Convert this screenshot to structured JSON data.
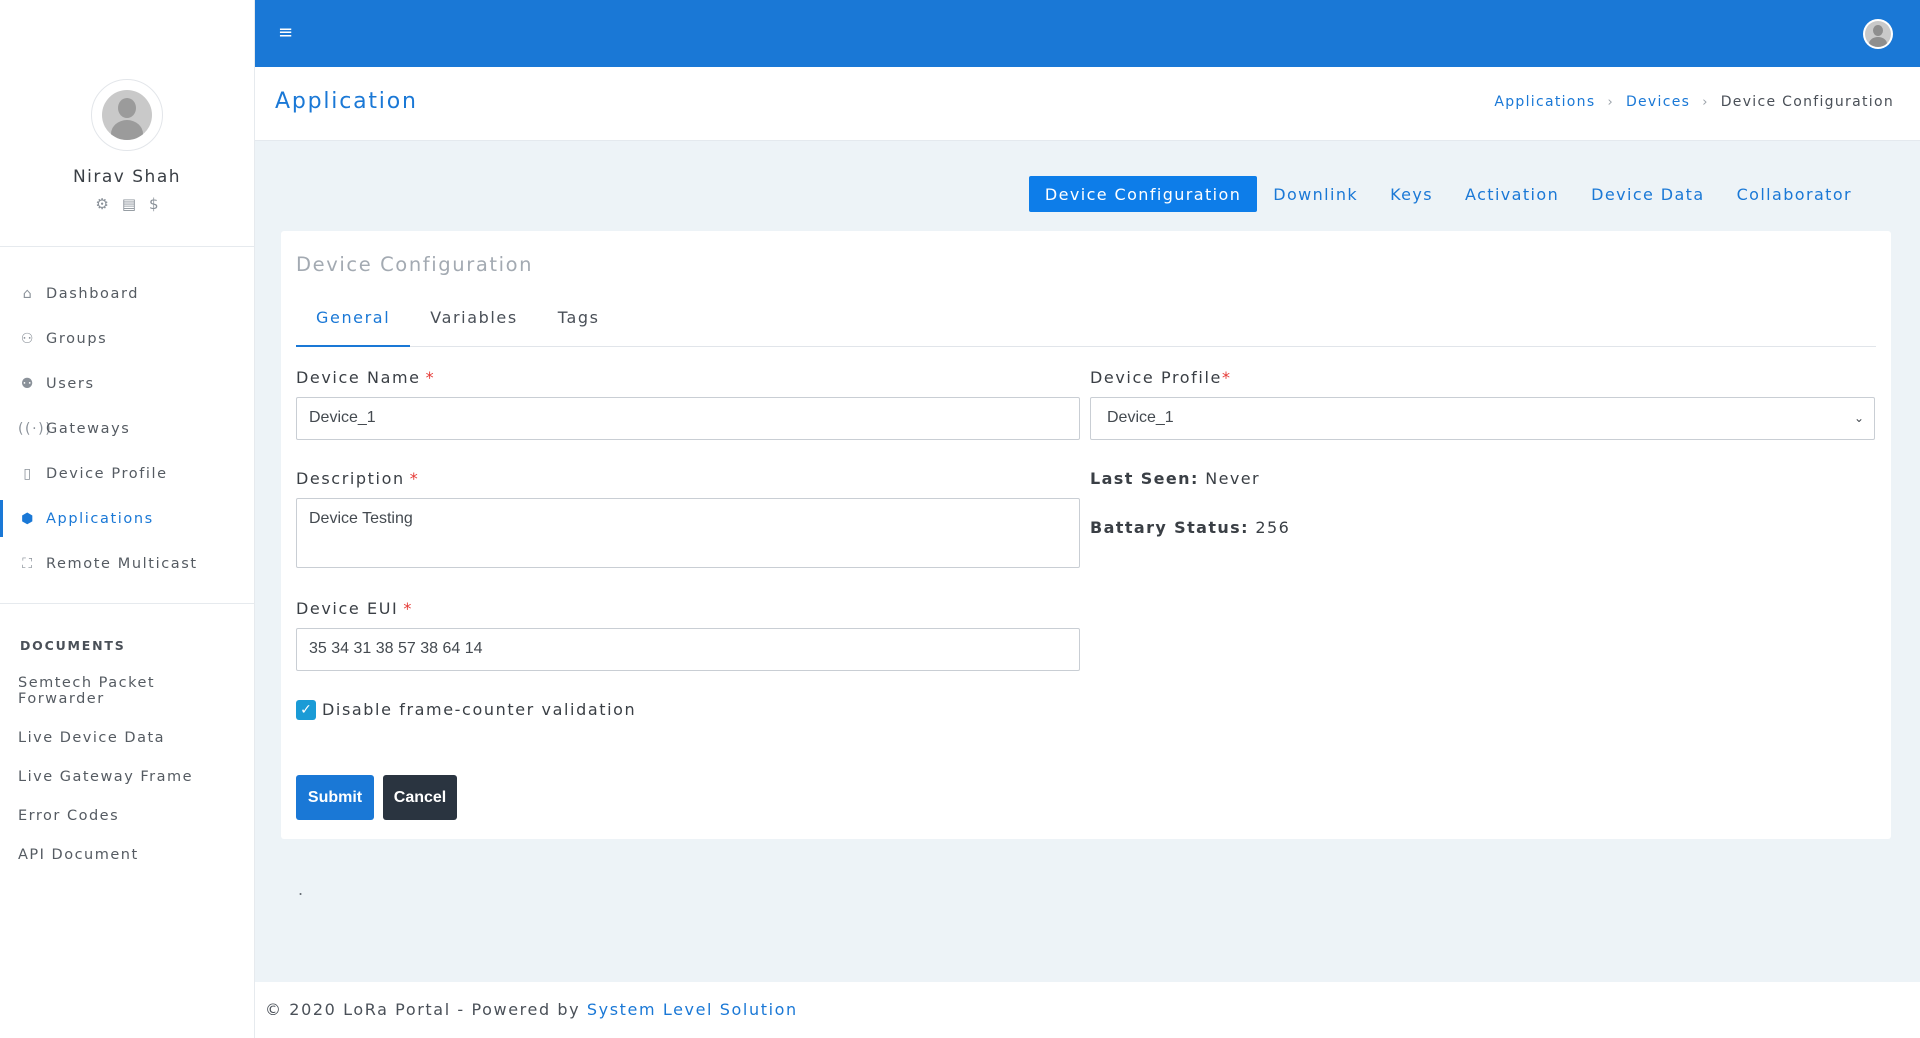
{
  "sidebar": {
    "user_name": "Nirav Shah",
    "user_icons": [
      "gear-icon",
      "document-icon",
      "dollar-icon"
    ],
    "nav": [
      {
        "label": "Dashboard",
        "icon": "home-icon"
      },
      {
        "label": "Groups",
        "icon": "groups-icon"
      },
      {
        "label": "Users",
        "icon": "users-icon"
      },
      {
        "label": "Gateways",
        "icon": "antenna-icon"
      },
      {
        "label": "Device Profile",
        "icon": "device-icon"
      },
      {
        "label": "Applications",
        "icon": "cube-icon",
        "active": true
      },
      {
        "label": "Remote Multicast",
        "icon": "multicast-icon"
      }
    ],
    "docs_heading": "DOCUMENTS",
    "docs": [
      "Semtech Packet Forwarder",
      "Live Device Data",
      "Live Gateway Frame",
      "Error Codes",
      "API Document"
    ]
  },
  "topbar": {
    "menu_icon": "hamburger-icon",
    "avatar_icon": "user-avatar-icon"
  },
  "header": {
    "title": "Application",
    "breadcrumb": [
      "Applications",
      "Devices",
      "Device Configuration"
    ]
  },
  "top_tabs": [
    "Device Configuration",
    "Downlink",
    "Keys",
    "Activation",
    "Device Data",
    "Collaborator"
  ],
  "card": {
    "title": "Device Configuration",
    "sub_tabs": [
      "General",
      "Variables",
      "Tags"
    ],
    "device_name_label": "Device Name",
    "device_name_value": "Device_1",
    "description_label": "Description",
    "description_value": "Device Testing",
    "device_eui_label": "Device EUI",
    "device_eui_value": "35 34 31 38 57 38 64 14",
    "device_profile_label": "Device Profile",
    "device_profile_value": "Device_1",
    "required_mark": "*",
    "last_seen_label": "Last Seen:",
    "last_seen_value": "Never",
    "battery_label": "Battary Status:",
    "battery_value": "256",
    "checkbox_label": "Disable frame-counter validation",
    "checkbox_checked": true,
    "submit_label": "Submit",
    "cancel_label": "Cancel"
  },
  "stray_text": ".",
  "footer": {
    "text": "© 2020 LoRa Portal - Powered by",
    "link": "System Level Solution"
  },
  "colors": {
    "accent": "#1a78d6",
    "active_tab": "#0d7de9",
    "cancel_button": "#2a3440",
    "required": "#e53935",
    "page_bg": "#edf3f7"
  }
}
